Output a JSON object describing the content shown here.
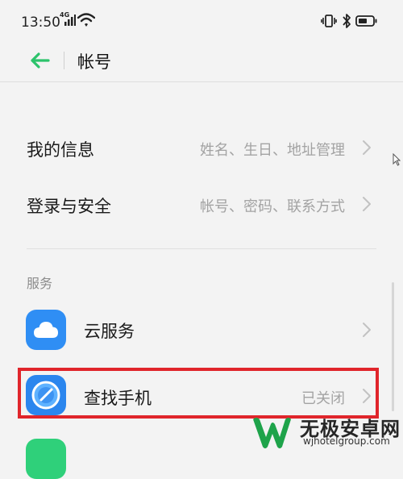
{
  "status_bar": {
    "time": "13:50",
    "network_type": "4G",
    "icons": [
      "signal-icon",
      "wifi-icon",
      "vibrate-icon",
      "bluetooth-icon",
      "battery-icon"
    ]
  },
  "header": {
    "back_icon": "arrow-left-icon",
    "title": "帐号"
  },
  "rows": {
    "my_info": {
      "label": "我的信息",
      "hint": "姓名、生日、地址管理"
    },
    "login_security": {
      "label": "登录与安全",
      "hint": "帐号、密码、联系方式"
    }
  },
  "services": {
    "section_label": "服务",
    "cloud": {
      "label": "云服务",
      "icon": "cloud-icon"
    },
    "find_phone": {
      "label": "查找手机",
      "hint": "已关闭",
      "icon": "find-phone-icon"
    }
  },
  "watermark": {
    "text": "无极安卓网",
    "url": "wjhotelgroup.com"
  },
  "colors": {
    "accent_green": "#2cc36b",
    "highlight_red": "#e0252b",
    "icon_blue": "#2f8ef4",
    "background": "#f3f3f3"
  }
}
